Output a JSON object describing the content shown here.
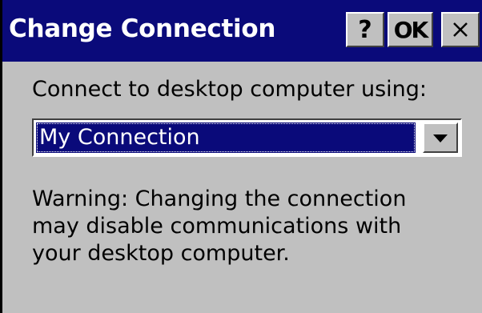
{
  "window": {
    "title": "Change Connection",
    "help_label": "?",
    "ok_label": "OK",
    "close_icon": "close-icon"
  },
  "colors": {
    "titlebar": "#0a0a7a",
    "face": "#c0c0c0",
    "selection": "#0a0a7a"
  },
  "form": {
    "prompt": "Connect to desktop computer using:",
    "connection_select": {
      "selected": "My Connection",
      "arrow_icon": "chevron-down-icon"
    },
    "warning_lines": [
      "Warning: Changing the connection",
      "may disable communications with",
      "your desktop computer."
    ]
  }
}
